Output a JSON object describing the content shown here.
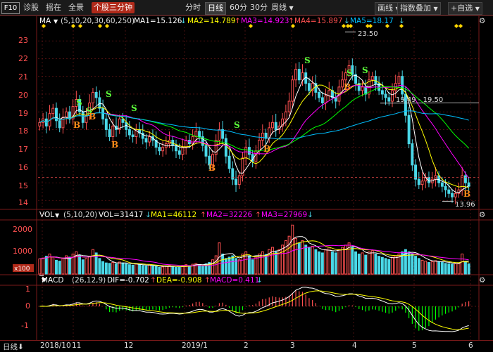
{
  "toolbar": {
    "f10": "F10",
    "left_items": [
      "诊股",
      "摇在",
      "全景"
    ],
    "active_tab": "个股三分钟",
    "period_tabs": [
      "分时",
      "日线",
      "60分",
      "30分",
      "周线"
    ],
    "selected_period": "日线",
    "right_items": [
      "画线",
      "指数叠加",
      "+自选"
    ]
  },
  "ma_header": {
    "name": "MA",
    "params": "(5,10,20,30,60,250)",
    "ma1": "MA1=15.126",
    "ma2": "MA2=14.789",
    "ma3": "MA3=14.923",
    "ma4": "MA4=15.897",
    "ma5": "MA5=18.17"
  },
  "vol_header": {
    "name": "VOL",
    "params": "(5,10,20)",
    "vol": "VOL=31417",
    "ma1": "MA1=46112",
    "ma2": "MA2=32226",
    "ma3": "MA3=27969"
  },
  "macd_header": {
    "name": "MACD",
    "params": "(26,12,9)",
    "dif": "DIF=-0.702",
    "dea": "DEA=-0.908",
    "macd": "MACD=0.411"
  },
  "price_axis": [
    "23",
    "22",
    "21",
    "20",
    "19",
    "18",
    "17",
    "16",
    "15",
    "14"
  ],
  "vol_axis": [
    "2000",
    "1000"
  ],
  "vol_unit": "x100",
  "macd_axis": [
    "1",
    "0",
    "-1"
  ],
  "date_labels": [
    "2018/10",
    "11",
    "12",
    "2019/1",
    "2",
    "3",
    "4",
    "5",
    "6"
  ],
  "footer_label": "日线",
  "annotations": {
    "high": "23.50",
    "low": "13.96",
    "range": "19.49 - 19.50"
  },
  "signals": {
    "buy": "B",
    "sell": "S"
  },
  "colors": {
    "up": "#ff5050",
    "down": "#4ad8e8",
    "ma1": "#ffffff",
    "ma2": "#ffff00",
    "ma3": "#ff00ff",
    "ma4": "#00ff00",
    "ma5": "#00bfff",
    "grid": "#7a1a1a",
    "buy": "#ff8c1a",
    "sell": "#5cff3a"
  },
  "chart_data": {
    "type": "candlestick",
    "price_ylim": [
      13.5,
      23.8
    ],
    "close": [
      18.4,
      18.6,
      18.2,
      18.9,
      19.2,
      18.5,
      18.1,
      18.7,
      19.0,
      18.6,
      19.3,
      19.7,
      19.0,
      18.4,
      18.8,
      19.5,
      20.1,
      19.8,
      19.2,
      18.6,
      18.0,
      17.6,
      18.2,
      18.0,
      18.6,
      18.4,
      18.0,
      17.7,
      17.6,
      18.0,
      17.8,
      17.5,
      17.3,
      17.6,
      17.4,
      17.0,
      16.8,
      17.0,
      17.2,
      17.4,
      17.1,
      16.8,
      16.6,
      17.0,
      17.4,
      17.2,
      17.6,
      17.9,
      17.6,
      17.1,
      16.5,
      16.0,
      16.6,
      17.4,
      18.0,
      17.5,
      16.5,
      15.8,
      15.2,
      14.9,
      15.4,
      16.4,
      17.0,
      16.6,
      16.2,
      16.8,
      17.4,
      17.8,
      17.5,
      18.1,
      18.4,
      18.0,
      18.2,
      18.6,
      19.0,
      19.6,
      20.8,
      21.4,
      20.8,
      21.2,
      20.6,
      20.2,
      20.6,
      20.1,
      19.8,
      19.5,
      19.9,
      20.2,
      19.8,
      19.6,
      20.4,
      20.8,
      21.2,
      21.6,
      21.1,
      20.6,
      20.2,
      20.4,
      20.0,
      20.8,
      21.0,
      20.6,
      20.2,
      20.0,
      19.8,
      19.6,
      20.2,
      20.6,
      21.0,
      20.0,
      18.8,
      17.2,
      16.0,
      15.2,
      14.9,
      15.1,
      15.3,
      15.0,
      15.2,
      15.4,
      15.0,
      14.8,
      14.6,
      14.4,
      14.2,
      14.4,
      14.6,
      15.4,
      15.0,
      14.8
    ],
    "volume": [
      680,
      720,
      800,
      900,
      760,
      620,
      580,
      700,
      820,
      760,
      900,
      1000,
      850,
      640,
      700,
      800,
      1100,
      950,
      700,
      560,
      500,
      480,
      520,
      460,
      540,
      500,
      460,
      420,
      400,
      460,
      420,
      380,
      360,
      400,
      380,
      340,
      300,
      320,
      360,
      380,
      340,
      300,
      300,
      360,
      420,
      380,
      440,
      480,
      420,
      380,
      460,
      520,
      640,
      820,
      1400,
      900,
      700,
      760,
      820,
      700,
      640,
      900,
      1000,
      820,
      640,
      760,
      900,
      1000,
      880,
      1100,
      1200,
      1000,
      1100,
      1300,
      1500,
      1700,
      2200,
      1600,
      1400,
      1500,
      1300,
      1200,
      1250,
      1100,
      1000,
      950,
      1100,
      1200,
      1000,
      950,
      1100,
      1200,
      1300,
      1400,
      1200,
      1000,
      900,
      950,
      850,
      1000,
      1050,
      900,
      800,
      750,
      700,
      650,
      760,
      800,
      900,
      1000,
      1100,
      1000,
      900,
      800,
      700,
      620,
      580,
      520,
      560,
      600,
      560,
      520,
      480,
      460,
      440,
      460,
      500,
      900,
      560,
      460
    ],
    "annotations": {
      "high": 23.5,
      "low": 13.96,
      "level_from": 19.49,
      "level_to": 19.5
    }
  }
}
